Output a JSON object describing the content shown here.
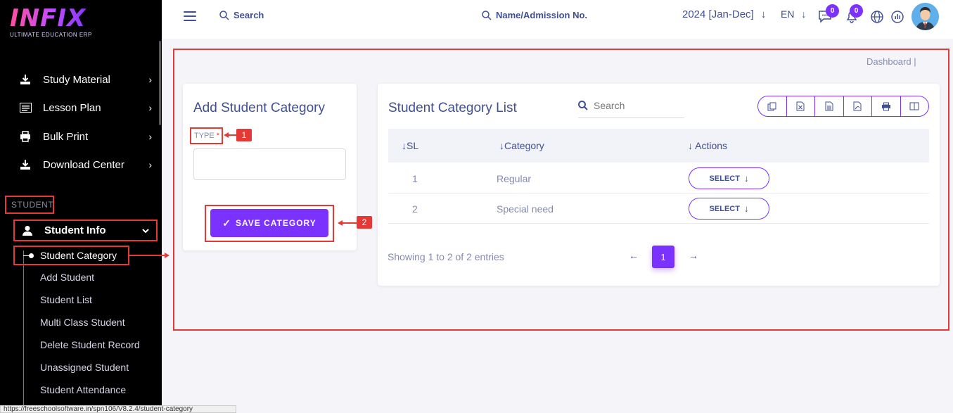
{
  "sidebar": {
    "logo_main": "INFIX",
    "logo_sub": "ULTIMATE EDUCATION ERP",
    "items": [
      {
        "label": "Study Material"
      },
      {
        "label": "Lesson Plan"
      },
      {
        "label": "Bulk Print"
      },
      {
        "label": "Download Center"
      }
    ],
    "section_label": "STUDENT",
    "open_menu": "Student Info",
    "sub_items": [
      {
        "label": "Student Category"
      },
      {
        "label": "Add Student"
      },
      {
        "label": "Student List"
      },
      {
        "label": "Multi Class Student"
      },
      {
        "label": "Delete Student Record"
      },
      {
        "label": "Unassigned Student"
      },
      {
        "label": "Student Attendance"
      }
    ],
    "status_url": "https://freeschoolsoftware.in/spn106/V8.2.4/student-category"
  },
  "header": {
    "search_label": "Search",
    "admission_search": "Name/Admission No.",
    "year": "2024 [Jan-Dec]",
    "lang": "EN",
    "chat_badge": "0",
    "notif_badge": "0"
  },
  "breadcrumb": "Dashboard   |",
  "add_form": {
    "title": "Add Student Category",
    "type_label": "TYPE",
    "required_mark": "*",
    "type_value": "",
    "save_label": "SAVE CATEGORY"
  },
  "markers": [
    "1",
    "2"
  ],
  "list": {
    "title": "Student Category List",
    "search_placeholder": "Search",
    "columns": [
      "SL",
      "Category",
      "Actions"
    ],
    "rows": [
      {
        "sl": "1",
        "category": "Regular",
        "action": "SELECT"
      },
      {
        "sl": "2",
        "category": "Special need",
        "action": "SELECT"
      }
    ],
    "showing": "Showing 1 to 2 of 2 entries",
    "page": "1"
  },
  "colors": {
    "accent": "#7c32ff",
    "annotation": "#e53935",
    "text": "#415094"
  }
}
